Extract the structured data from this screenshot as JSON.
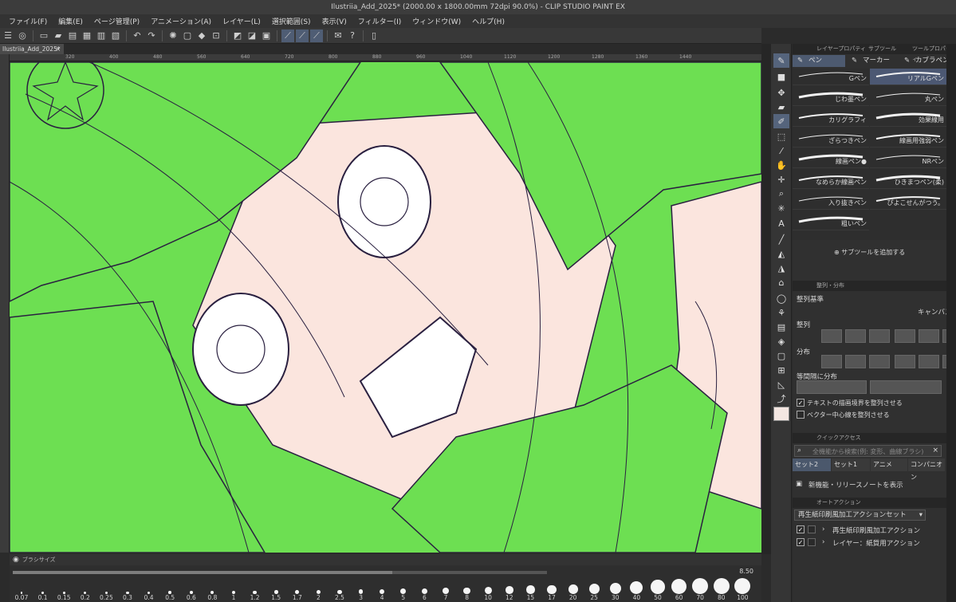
{
  "window_title": "Ilustriia_Add_2025* (2000.00 x 1800.00mm 72dpi 90.0%) - CLIP STUDIO PAINT EX",
  "menu": [
    "ファイル(F)",
    "編集(E)",
    "ページ管理(P)",
    "アニメーション(A)",
    "レイヤー(L)",
    "選択範囲(S)",
    "表示(V)",
    "フィルター(I)",
    "ウィンドウ(W)",
    "ヘルプ(H)"
  ],
  "document_tab": "Ilustriia_Add_2025*",
  "document_tab_close": "×",
  "ruler_labels": [
    "320",
    "400",
    "480",
    "560",
    "640",
    "720",
    "800",
    "880",
    "960",
    "1040",
    "1120",
    "1200",
    "1280",
    "1360",
    "1440"
  ],
  "canvas_color": "#6ddf52",
  "tool_panel": {
    "tabs": [
      "レイヤープロパティ",
      "サブツール",
      "ツールプロパティ"
    ],
    "subtool_tabs": [
      "ペン",
      "マーカー",
      "カブラペン"
    ],
    "brushes": [
      {
        "name": "Gペン"
      },
      {
        "name": "リアルGペン"
      },
      {
        "name": "じわ墨ペン"
      },
      {
        "name": "丸ペン"
      },
      {
        "name": "カリグラフィ"
      },
      {
        "name": "効果線用"
      },
      {
        "name": "ざらつきペン"
      },
      {
        "name": "線画用強弱ペン"
      },
      {
        "name": "線画ペン●"
      },
      {
        "name": "NRペン"
      },
      {
        "name": "なめらか線画ペン"
      },
      {
        "name": "ひきまつペン(柔)"
      },
      {
        "name": "入り抜きペン"
      },
      {
        "name": "ぴよこせんがつう。"
      },
      {
        "name": "粗いペン"
      }
    ],
    "add_subtool": "サブツールを追加する"
  },
  "align_panel": {
    "title": "整列・分布",
    "basis_label": "整列基準",
    "basis_value": "キャンバス",
    "align_label": "整列",
    "distribute_label": "分布",
    "equal_spacing_label": "等間隔に分布",
    "check_text_bounds": "テキストの描画境界を整列させる",
    "check_vector_center": "ベクター中心線を整列させる",
    "text_bounds_checked": true,
    "vector_center_checked": false
  },
  "quick_access": {
    "title": "クイックアクセス",
    "search_placeholder": "全機能から検索(例: 変形、曲線ブラシ)",
    "tabs": [
      "セット2",
      "セット1",
      "アニメ",
      "コンパニオン"
    ],
    "item": "新機能・リリースノートを表示"
  },
  "auto_action": {
    "title": "オートアクション",
    "set_name": "再生紙印刷風加工アクションセット",
    "actions": [
      "再生紙印刷風加工アクション",
      "レイヤー：紙質用アクション"
    ]
  },
  "brush_size": {
    "title": "ブラシサイズ",
    "value": "8.50",
    "slider_fraction": 0.71,
    "presets": [
      "0.07",
      "0.1",
      "0.15",
      "0.2",
      "0.25",
      "0.3",
      "0.4",
      "0.5",
      "0.6",
      "0.8",
      "1",
      "1.2",
      "1.5",
      "1.7",
      "2",
      "2.5",
      "3",
      "4",
      "5",
      "6",
      "7",
      "8",
      "10",
      "12",
      "15",
      "17",
      "20",
      "25",
      "30",
      "40",
      "50",
      "60",
      "70",
      "80",
      "100"
    ]
  },
  "icons": [
    "menu-icon",
    "pen-icon",
    "marker-icon",
    "brush-icon",
    "eraser-icon",
    "hand-icon",
    "move-icon",
    "zoom-icon",
    "text-icon",
    "bucket-icon",
    "search-icon",
    "add-icon",
    "close-icon"
  ]
}
